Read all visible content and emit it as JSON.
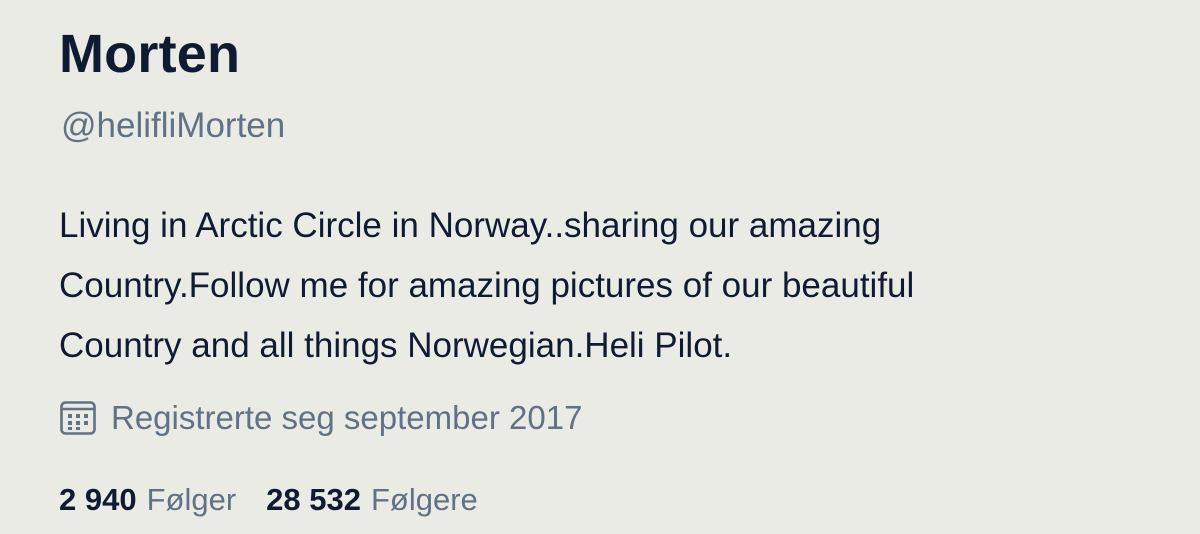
{
  "profile": {
    "name": "Morten",
    "handle": "@helifliMorten",
    "bio_lines": [
      "Living in Arctic Circle in Norway..sharing our amazing",
      "Country.Follow me for amazing pictures of our beautiful",
      "Country and all things Norwegian.Heli Pilot."
    ],
    "joined": {
      "icon": "calendar-icon",
      "text": "Registrerte seg september 2017"
    },
    "stats": {
      "following_count": "2 940",
      "following_label": "Følger",
      "followers_count": "28 532",
      "followers_label": "Følgere"
    }
  },
  "colors": {
    "background": "#ebebe6",
    "primary_text": "#0f1b33",
    "secondary_text": "#5f7286"
  }
}
